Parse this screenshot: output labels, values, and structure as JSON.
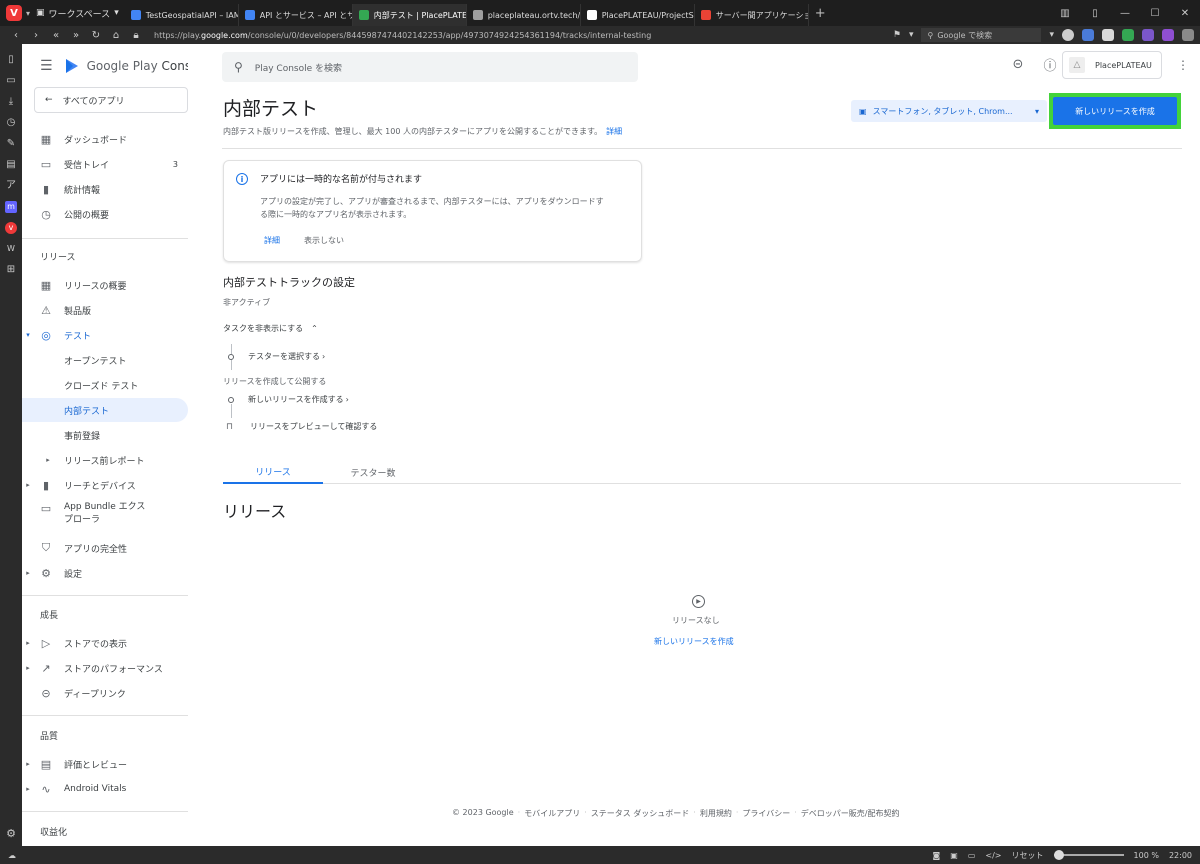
{
  "browser": {
    "workspace_label": "ワークスペース",
    "tabs": [
      {
        "title": "TestGeospatialAPI – IAM と",
        "color": "#4285f4"
      },
      {
        "title": "API とサービス – API とサービス",
        "color": "#4285f4"
      },
      {
        "title": "内部テスト | PlacePLATEAU",
        "color": "#34a853"
      },
      {
        "title": "placeplateau.ortv.tech/toke",
        "color": "#9e9e9e"
      },
      {
        "title": "PlacePLATEAU/ProjectSetti",
        "color": "#ffffff"
      },
      {
        "title": "サーバー間アプリケーションに OA",
        "color": "#ea4335"
      }
    ],
    "url_prefix": "https://play.",
    "url_domain": "google.com",
    "url_path": "/console/u/0/developers/8445987474402142253/app/4973074924254361194/tracks/internal-testing",
    "search_placeholder": "Google で検索",
    "status": {
      "reset": "リセット",
      "zoom": "100 %",
      "time": "22:00"
    }
  },
  "app": {
    "brand_google": "Google Play",
    "brand_console": "Console",
    "all_apps": "すべてのアプリ",
    "search_placeholder": "Play Console を検索",
    "account_name": "PlacePLATEAU",
    "nav": {
      "dashboard": "ダッシュボード",
      "inbox": "受信トレイ",
      "inbox_count": "3",
      "stats": "統計情報",
      "publishing": "公開の概要",
      "section_release": "リリース",
      "release_overview": "リリースの概要",
      "production": "製品版",
      "testing": "テスト",
      "open_testing": "オープンテスト",
      "closed_testing": "クローズド テスト",
      "internal_testing": "内部テスト",
      "pre_registration": "事前登録",
      "pre_launch": "リリース前レポート",
      "reach_devices": "リーチとデバイス",
      "bundle_explorer": "App Bundle エクスプローラ",
      "app_integrity": "アプリの完全性",
      "settings": "設定",
      "section_grow": "成長",
      "store_presence": "ストアでの表示",
      "store_performance": "ストアのパフォーマンス",
      "deep_links": "ディープリンク",
      "section_quality": "品質",
      "ratings_reviews": "評価とレビュー",
      "android_vitals": "Android Vitals",
      "section_monetize": "収益化"
    },
    "page": {
      "title": "内部テスト",
      "description": "内部テスト版リリースを作成、管理し、最大 100 人の内部テスターにアプリを公開することができます。",
      "details_link": "詳細",
      "device_selector": "スマートフォン, タブレット, Chrom...",
      "new_release_button": "新しいリリースを作成"
    },
    "info_card": {
      "title": "アプリには一時的な名前が付与されます",
      "body": "アプリの設定が完了し、アプリが審査されるまで、内部テスターには、アプリをダウンロードする際に一時的なアプリ名が表示されます。",
      "details": "詳細",
      "dismiss": "表示しない"
    },
    "track": {
      "title": "内部テストトラックの設定",
      "status": "非アクティブ",
      "hide_tasks": "タスクを非表示にする",
      "task_select_testers": "テスターを選択する",
      "group_label": "リリースを作成して公開する",
      "task_new_release": "新しいリリースを作成する",
      "task_preview": "リリースをプレビューして確認する"
    },
    "tabs": {
      "releases": "リリース",
      "testers": "テスター数"
    },
    "releases": {
      "section_title": "リリース",
      "empty_text": "リリースなし",
      "empty_link": "新しいリリースを作成"
    },
    "footer": {
      "copyright": "© 2023 Google",
      "mobile_app": "モバイルアプリ",
      "status_dashboard": "ステータス ダッシュボード",
      "terms": "利用規約",
      "privacy": "プライバシー",
      "dda": "デベロッパー販売/配布契約"
    }
  }
}
